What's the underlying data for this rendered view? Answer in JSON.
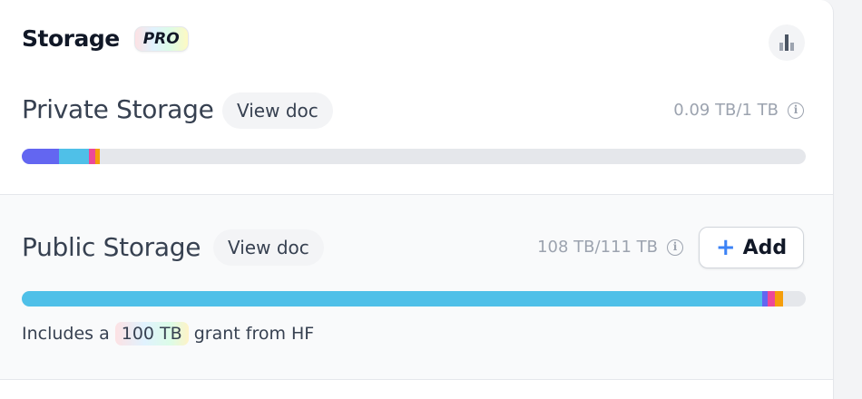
{
  "header": {
    "title": "Storage",
    "badge": "PRO"
  },
  "private_storage": {
    "title": "Private Storage",
    "doc_label": "View doc",
    "usage": "0.09 TB/1 TB",
    "segments": [
      {
        "color": "#6366f1",
        "fraction": 0.048
      },
      {
        "color": "#4fc0e8",
        "fraction": 0.038
      },
      {
        "color": "#ec4899",
        "fraction": 0.008
      },
      {
        "color": "#f59e0b",
        "fraction": 0.006
      }
    ]
  },
  "public_storage": {
    "title": "Public Storage",
    "doc_label": "View doc",
    "usage": "108 TB/111 TB",
    "add_label": "Add",
    "segments": [
      {
        "color": "#4fc0e8",
        "fraction": 0.945
      },
      {
        "color": "#6366f1",
        "fraction": 0.006
      },
      {
        "color": "#ec4899",
        "fraction": 0.01
      },
      {
        "color": "#f59e0b",
        "fraction": 0.01
      }
    ],
    "grant": {
      "prefix": "Includes a",
      "amount": "100 TB",
      "suffix": "grant from HF"
    }
  },
  "icons": {
    "stats": "bar-chart-icon",
    "info": "info-icon",
    "add": "plus-icon"
  }
}
